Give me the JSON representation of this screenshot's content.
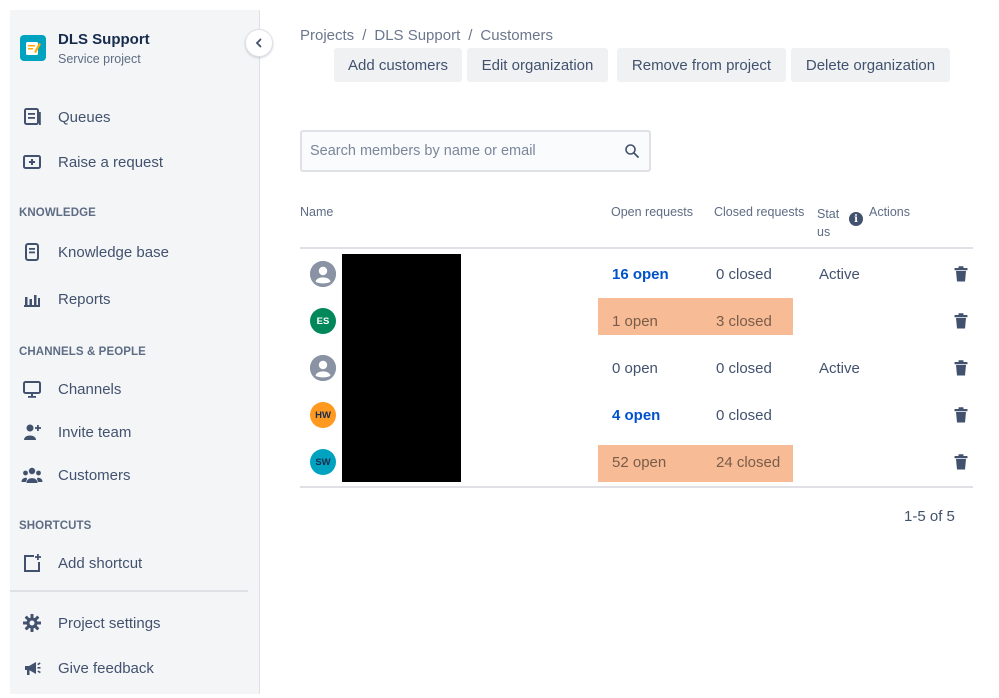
{
  "project": {
    "name": "DLS Support",
    "type": "Service project"
  },
  "nav": {
    "queues": "Queues",
    "raise_request": "Raise a request",
    "knowledge_section": "KNOWLEDGE",
    "knowledge_base": "Knowledge base",
    "reports": "Reports",
    "channels_section": "CHANNELS & PEOPLE",
    "channels": "Channels",
    "invite_team": "Invite team",
    "customers": "Customers",
    "shortcuts_section": "SHORTCUTS",
    "add_shortcut": "Add shortcut",
    "project_settings": "Project settings",
    "give_feedback": "Give feedback"
  },
  "breadcrumb": [
    "Projects",
    "DLS Support",
    "Customers"
  ],
  "breadcrumb_sep": "/",
  "toolbar": {
    "add_customers": "Add customers",
    "edit_organization": "Edit organization",
    "remove_from_project": "Remove from project",
    "delete_organization": "Delete organization"
  },
  "search": {
    "placeholder": "Search members by name or email"
  },
  "table": {
    "headers": {
      "name": "Name",
      "open": "Open requests",
      "closed": "Closed requests",
      "status_line1": "Stat",
      "status_line2": "us",
      "actions": "Actions"
    },
    "rows": [
      {
        "avatar": "",
        "avatar_type": "default-user-icon",
        "open": "16 open",
        "open_link": true,
        "closed": "0 closed",
        "status": "Active",
        "highlight": false
      },
      {
        "avatar": "ES",
        "avatar_color": "#00875a",
        "open": "1 open",
        "open_link": false,
        "closed": "3 closed",
        "status": "",
        "highlight": true
      },
      {
        "avatar": "",
        "avatar_type": "default-user-icon",
        "open": "0 open",
        "open_link": false,
        "closed": "0 closed",
        "status": "Active",
        "highlight": false
      },
      {
        "avatar": "HW",
        "avatar_color": "#ff991f",
        "open": "4 open",
        "open_link": true,
        "closed": "0 closed",
        "status": "",
        "highlight": false
      },
      {
        "avatar": "SW",
        "avatar_color": "#00a3bf",
        "open": "52 open",
        "open_link": false,
        "closed": "24 closed",
        "status": "",
        "highlight": true
      }
    ]
  },
  "pagination": "1-5 of 5",
  "colors": {
    "highlight": "#f7bc96",
    "link": "#0052cc",
    "sidebar_bg": "#f4f5f7"
  }
}
